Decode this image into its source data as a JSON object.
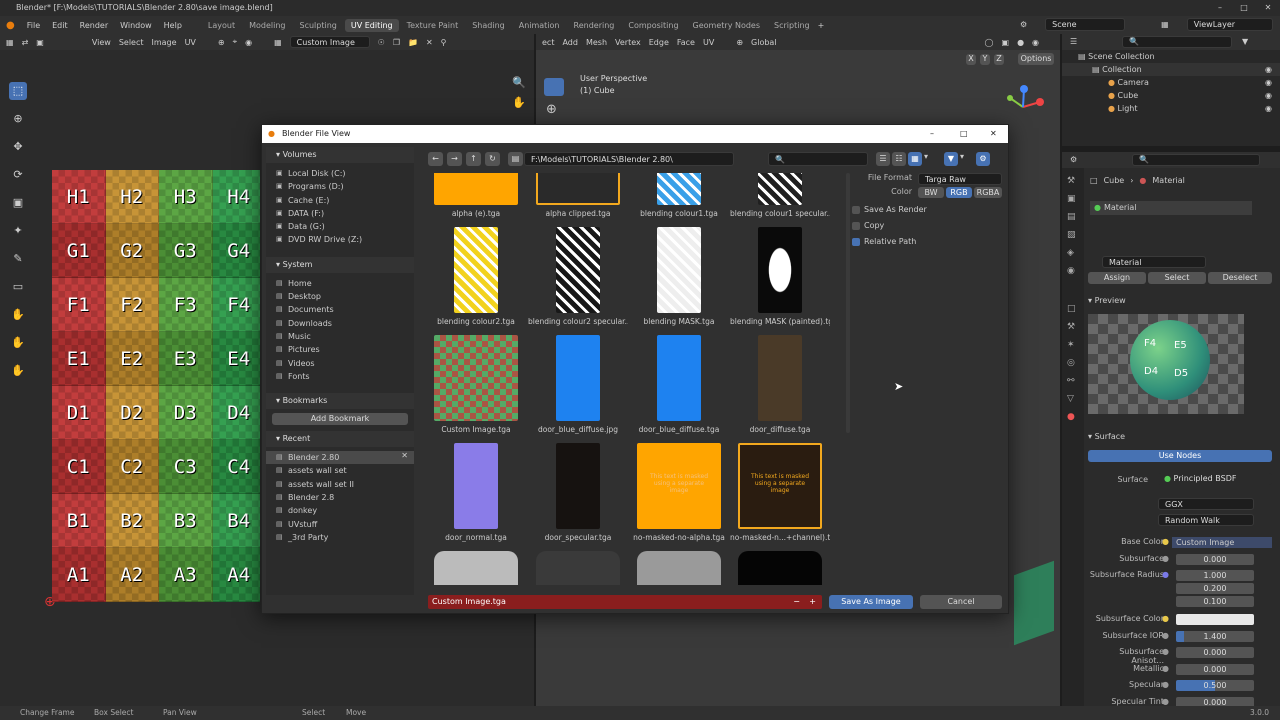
{
  "window": {
    "title": "Blender* [F:\\Models\\TUTORIALS\\Blender 2.80\\save image.blend]"
  },
  "menu": [
    "File",
    "Edit",
    "Render",
    "Window",
    "Help"
  ],
  "workspaces": [
    "Layout",
    "Modeling",
    "Sculpting",
    "UV Editing",
    "Texture Paint",
    "Shading",
    "Animation",
    "Rendering",
    "Compositing",
    "Geometry Nodes",
    "Scripting"
  ],
  "scene": {
    "label": "Scene",
    "view_layer": "ViewLayer"
  },
  "uv_editor": {
    "menus": [
      "View",
      "Select",
      "Image",
      "UV"
    ],
    "image_name": "Custom Image",
    "grid_rows": [
      "H",
      "G",
      "F",
      "E",
      "D",
      "C",
      "B",
      "A"
    ],
    "grid_cols": [
      "1",
      "2",
      "3",
      "4"
    ],
    "row_colors": [
      "#c03535",
      "#c5902f",
      "#55a23c",
      "#2d9c4a"
    ]
  },
  "viewport": {
    "menus": [
      "ect",
      "Add",
      "Mesh",
      "Vertex",
      "Edge",
      "Face",
      "UV"
    ],
    "orientation": "Global",
    "options": "Options",
    "view_label": "User Perspective",
    "object_label": "(1) Cube",
    "axes": [
      "X",
      "Y",
      "Z"
    ]
  },
  "dialog": {
    "title": "Blender File View",
    "path": "F:\\Models\\TUTORIALS\\Blender 2.80\\",
    "volumes_title": "Volumes",
    "volumes": [
      "Local Disk (C:)",
      "Programs (D:)",
      "Cache (E:)",
      "DATA (F:)",
      "Data (G:)",
      "DVD RW Drive (Z:)"
    ],
    "system_title": "System",
    "system": [
      "Home",
      "Desktop",
      "Documents",
      "Downloads",
      "Music",
      "Pictures",
      "Videos",
      "Fonts"
    ],
    "bookmarks_title": "Bookmarks",
    "add_bookmark": "Add Bookmark",
    "recent_title": "Recent",
    "recent": [
      "Blender 2.80",
      "assets wall set",
      "assets wall set II",
      "Blender 2.8",
      "donkey",
      "UVstuff",
      "_3rd Party"
    ],
    "files": [
      {
        "name": "alpha (e).tga",
        "color": "#ffa500"
      },
      {
        "name": "alpha clipped.tga",
        "color": "#2a2a2a"
      },
      {
        "name": "blending colour1.tga",
        "color": "#3aa0e8"
      },
      {
        "name": "blending colour1 specular...",
        "color": "#202020"
      },
      {
        "name": "blending colour2.tga",
        "color": "#f2d21e"
      },
      {
        "name": "blending colour2 specular...",
        "color": "#181818"
      },
      {
        "name": "blending MASK.tga",
        "color": "#eeeeee"
      },
      {
        "name": "blending MASK (painted).tg",
        "color": "#0a0a0a"
      },
      {
        "name": "Custom Image.tga",
        "color": "#7a4a6a"
      },
      {
        "name": "door_blue_diffuse.jpg",
        "color": "#1e82f0"
      },
      {
        "name": "door_blue_diffuse.tga",
        "color": "#1e82f0"
      },
      {
        "name": "door_diffuse.tga",
        "color": "#4a3a28"
      },
      {
        "name": "door_normal.tga",
        "color": "#8a7ce8"
      },
      {
        "name": "door_specular.tga",
        "color": "#161210"
      },
      {
        "name": "no-masked-no-alpha.tga",
        "color": "#ffa500"
      },
      {
        "name": "no-masked-n...+channel).tg",
        "color": "#2a1c10"
      },
      {
        "name": "",
        "color": "#bbbbbb"
      },
      {
        "name": "",
        "color": "#3a3a3a"
      },
      {
        "name": "",
        "color": "#9a9a9a"
      },
      {
        "name": "",
        "color": "#050505"
      }
    ],
    "file_format_label": "File Format",
    "file_format": "Targa Raw",
    "color_label": "Color",
    "color_modes": [
      "BW",
      "RGB",
      "RGBA"
    ],
    "active_color_mode": "RGB",
    "options": [
      {
        "label": "Save As Render",
        "checked": false
      },
      {
        "label": "Copy",
        "checked": false
      },
      {
        "label": "Relative Path",
        "checked": true
      }
    ],
    "filename": "Custom Image.tga",
    "save_button": "Save As Image",
    "cancel_button": "Cancel",
    "masked_text": "This text is masked using a separate image"
  },
  "outliner": {
    "root": "Scene Collection",
    "collection": "Collection",
    "items": [
      "Camera",
      "Cube",
      "Light"
    ]
  },
  "properties": {
    "breadcrumb_object": "Cube",
    "breadcrumb_material": "Material",
    "slot": "Material",
    "material": "Material",
    "assign": "Assign",
    "select": "Select",
    "deselect": "Deselect",
    "preview": "Preview",
    "surface_section": "Surface",
    "use_nodes": "Use Nodes",
    "surface_label": "Surface",
    "surface_value": "Principled BSDF",
    "distribution": "GGX",
    "subsurface_method": "Random Walk",
    "rows": [
      {
        "label": "Base Color",
        "value": "Custom Image"
      },
      {
        "label": "Subsurface",
        "value": "0.000"
      },
      {
        "label": "Subsurface Radius",
        "value": "1.000"
      },
      {
        "label": "",
        "value": "0.200"
      },
      {
        "label": "",
        "value": "0.100"
      },
      {
        "label": "Subsurface Color",
        "value": ""
      },
      {
        "label": "Subsurface IOR",
        "value": "1.400"
      },
      {
        "label": "Subsurface Anisot...",
        "value": "0.000"
      },
      {
        "label": "Metallic",
        "value": "0.000"
      },
      {
        "label": "Specular",
        "value": "0.500"
      },
      {
        "label": "Specular Tint",
        "value": "0.000"
      }
    ],
    "sphere_labels": [
      "F4",
      "E5",
      "D4",
      "D5"
    ]
  },
  "status": {
    "items": [
      "Change Frame",
      "Box Select",
      "Pan View",
      "Select",
      "Move"
    ],
    "version": "3.0.0"
  }
}
